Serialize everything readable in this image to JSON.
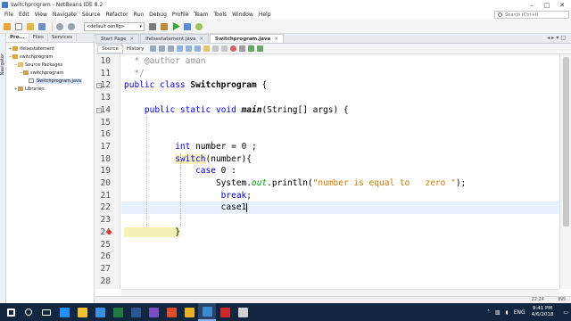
{
  "window": {
    "title": "switchprogram - NetBeans IDE 8.2",
    "controls": [
      "–",
      "□",
      "✕"
    ]
  },
  "menubar": {
    "items": [
      "File",
      "Edit",
      "View",
      "Navigate",
      "Source",
      "Refactor",
      "Run",
      "Debug",
      "Profile",
      "Team",
      "Tools",
      "Window",
      "Help"
    ]
  },
  "search": {
    "placeholder": "Search (Ctrl+I)"
  },
  "toolbar": {
    "config_value": "<default config>",
    "icons": [
      "new-project-icon",
      "new-file-icon",
      "open-project-icon",
      "save-all-icon",
      "undo-icon",
      "redo-icon",
      "build-icon",
      "clean-build-icon",
      "run-icon",
      "debug-icon",
      "profile-icon"
    ]
  },
  "navigator_label": "Navigator",
  "left_panel": {
    "tabs": [
      "Pro...",
      "Files",
      "Services"
    ],
    "tree": [
      {
        "label": "ifelsestatement",
        "depth": 0,
        "toggle": "+",
        "icon": "project"
      },
      {
        "label": "switchprogram",
        "depth": 0,
        "toggle": "−",
        "icon": "project"
      },
      {
        "label": "Source Packages",
        "depth": 1,
        "toggle": "−",
        "icon": "folder"
      },
      {
        "label": "switchprogram",
        "depth": 2,
        "toggle": "−",
        "icon": "package"
      },
      {
        "label": "Switchprogram.java",
        "depth": 3,
        "toggle": "",
        "icon": "java",
        "selected": true
      },
      {
        "label": "Libraries",
        "depth": 1,
        "toggle": "+",
        "icon": "library"
      }
    ]
  },
  "editor_tabs": [
    {
      "label": "Start Page",
      "active": false
    },
    {
      "label": "Ifelsestatement.java",
      "active": false
    },
    {
      "label": "Switchprogram.java",
      "active": true
    }
  ],
  "editor_views": [
    "Source",
    "History"
  ],
  "code_lines": [
    {
      "n": "10",
      "segments": [
        {
          "t": "  * @author aman",
          "c": "cmt"
        }
      ]
    },
    {
      "n": "11",
      "segments": [
        {
          "t": "  */",
          "c": "cmt"
        }
      ]
    },
    {
      "n": "12",
      "segments": [
        {
          "t": "public class ",
          "c": "kw"
        },
        {
          "t": "Switchprogram",
          "c": "bold"
        },
        {
          "t": " {",
          "c": ""
        }
      ]
    },
    {
      "n": "13",
      "segments": []
    },
    {
      "n": "14",
      "segments": [
        {
          "t": "    public static void ",
          "c": "kw"
        },
        {
          "t": "main",
          "c": "bold-it"
        },
        {
          "t": "(String[] args) {",
          "c": ""
        }
      ]
    },
    {
      "n": "15",
      "segments": []
    },
    {
      "n": "16",
      "segments": []
    },
    {
      "n": "17",
      "segments": [
        {
          "t": "          int",
          "c": "kw"
        },
        {
          "t": " number = ",
          "c": ""
        },
        {
          "t": "0",
          "c": ""
        },
        {
          "t": " ;",
          "c": ""
        }
      ]
    },
    {
      "n": "18",
      "segments": [
        {
          "t": "          ",
          "c": ""
        },
        {
          "t": "switch",
          "c": "kw-hl"
        },
        {
          "t": "(number){",
          "c": ""
        }
      ]
    },
    {
      "n": "19",
      "segments": [
        {
          "t": "              case ",
          "c": "kw"
        },
        {
          "t": "0",
          "c": ""
        },
        {
          "t": " :",
          "c": ""
        }
      ]
    },
    {
      "n": "20",
      "segments": [
        {
          "t": "                  System.",
          "c": ""
        },
        {
          "t": "out",
          "c": "it"
        },
        {
          "t": ".println(",
          "c": ""
        },
        {
          "t": "\"number is equal to   zero \"",
          "c": "str"
        },
        {
          "t": ");",
          "c": ""
        }
      ]
    },
    {
      "n": "21",
      "segments": [
        {
          "t": "                   break",
          "c": "kw"
        },
        {
          "t": ";",
          "c": ""
        }
      ]
    },
    {
      "n": "22",
      "segments": [
        {
          "t": "                   case1",
          "c": ""
        }
      ]
    },
    {
      "n": "23",
      "segments": []
    },
    {
      "n": "24",
      "segments": [
        {
          "t": "          }",
          "c": "hl"
        }
      ]
    },
    {
      "n": "25",
      "segments": []
    },
    {
      "n": "26",
      "segments": []
    },
    {
      "n": "27",
      "segments": []
    },
    {
      "n": "28",
      "segments": []
    }
  ],
  "status": {
    "position": "22:24",
    "mode": "INS"
  },
  "taskbar": {
    "apps": [
      {
        "name": "start-icon",
        "color": "#ffffff"
      },
      {
        "name": "search-icon",
        "color": "#ffffff"
      },
      {
        "name": "task-view-icon",
        "color": "#ffffff"
      },
      {
        "name": "edge-icon",
        "color": "#1e90ff"
      },
      {
        "name": "file-explorer-icon",
        "color": "#f2c12e"
      },
      {
        "name": "store-icon",
        "color": "#3b8fe0"
      },
      {
        "name": "excel-icon",
        "color": "#1f7a3f"
      },
      {
        "name": "word-icon",
        "color": "#2b5797"
      },
      {
        "name": "visual-studio-icon",
        "color": "#7a4fc4"
      },
      {
        "name": "media-player-icon",
        "color": "#e04c2a"
      },
      {
        "name": "chrome-icon",
        "color": "#e8b423"
      },
      {
        "name": "netbeans-icon",
        "color": "#3a8ad8"
      },
      {
        "name": "app-icon",
        "color": "#cc2a2a"
      },
      {
        "name": "code-icon",
        "color": "#d0d0d0"
      }
    ],
    "language": "ENG",
    "time": "9:41 PM",
    "date": "4/6/2018"
  }
}
